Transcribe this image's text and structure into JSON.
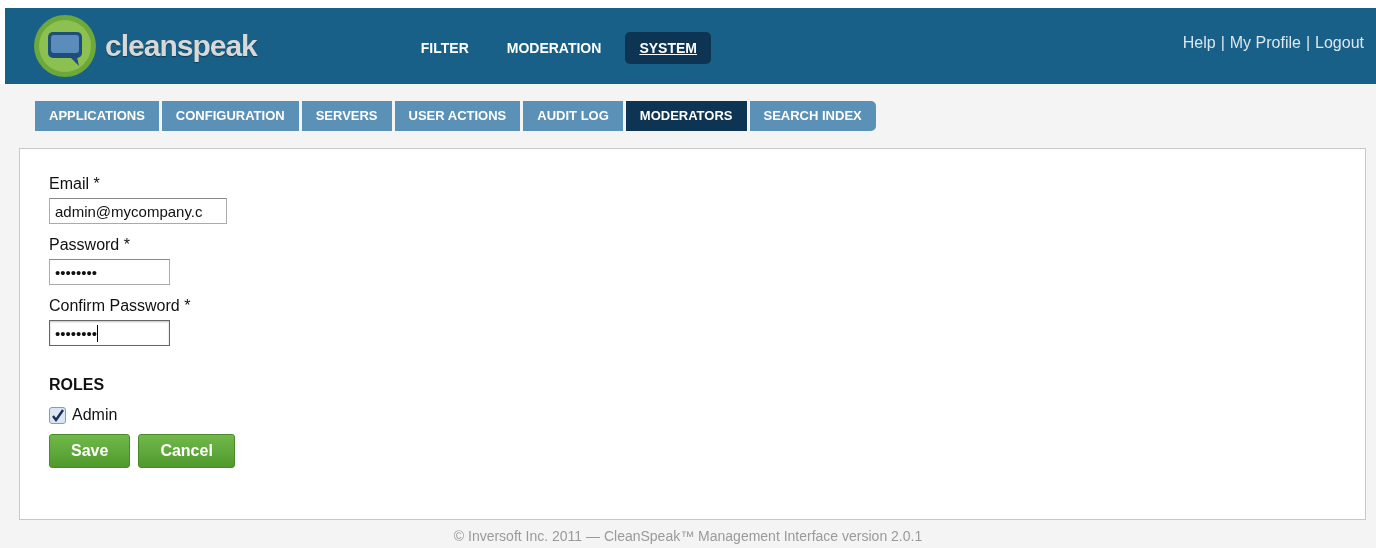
{
  "header": {
    "logo_text": "cleanspeak",
    "nav": [
      {
        "label": "FILTER",
        "selected": false
      },
      {
        "label": "MODERATION",
        "selected": false
      },
      {
        "label": "SYSTEM",
        "selected": true
      }
    ],
    "links": [
      "Help",
      "My Profile",
      "Logout"
    ],
    "separator": "|"
  },
  "subnav": [
    {
      "label": "APPLICATIONS",
      "selected": false
    },
    {
      "label": "CONFIGURATION",
      "selected": false
    },
    {
      "label": "SERVERS",
      "selected": false
    },
    {
      "label": "USER ACTIONS",
      "selected": false
    },
    {
      "label": "AUDIT LOG",
      "selected": false
    },
    {
      "label": "MODERATORS",
      "selected": true
    },
    {
      "label": "SEARCH INDEX",
      "selected": false
    }
  ],
  "form": {
    "fields": [
      {
        "label": "Email *",
        "value": "admin@mycompany.c",
        "kind": "wide",
        "focused": false
      },
      {
        "label": "Password *",
        "value": "••••••••",
        "kind": "narrow",
        "focused": false
      },
      {
        "label": "Confirm Password *",
        "value": "••••••••",
        "kind": "narrow",
        "focused": true
      }
    ],
    "roles_heading": "ROLES",
    "roles": [
      {
        "label": "Admin",
        "checked": true
      }
    ],
    "buttons": [
      "Save",
      "Cancel"
    ]
  },
  "footer": "© Inversoft Inc. 2011 — CleanSpeak™ Management Interface version 2.0.1"
}
